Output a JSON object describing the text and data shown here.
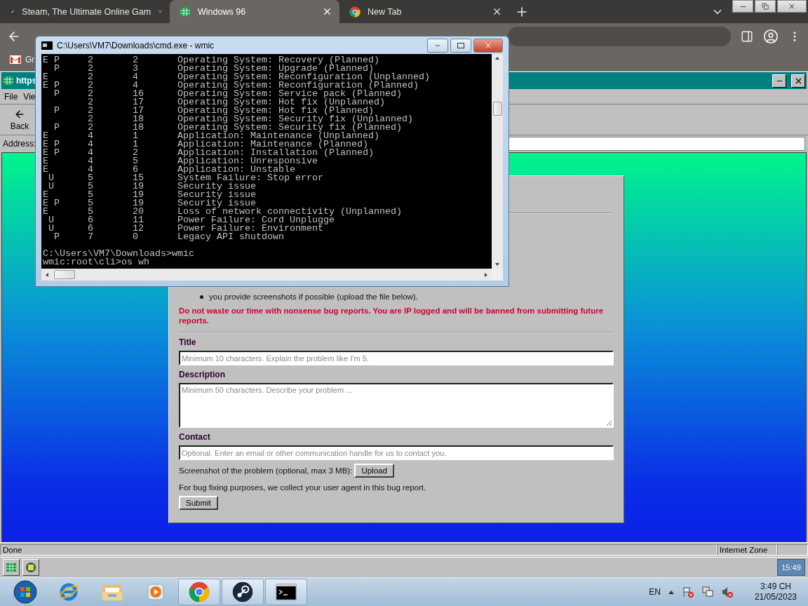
{
  "browser": {
    "tabs": [
      {
        "title": "Steam, The Ultimate Online Gam",
        "selected": false
      },
      {
        "title": "Windows 96",
        "selected": true
      },
      {
        "title": "New Tab",
        "selected": false
      }
    ],
    "bookmarks": [
      "Gr"
    ]
  },
  "ie_window": {
    "title": "https",
    "menu": [
      "File",
      "Vie"
    ],
    "back_label": "Back",
    "address_label": "Address:"
  },
  "page": {
    "bullets": [
      "you provide screenshots if possible (upload the file below)."
    ],
    "warning": "Do not waste our time with nonsense bug reports. You are IP logged and will be banned from submitting future reports.",
    "fields": [
      {
        "label": "Title",
        "placeholder": "Minimum 10 characters. Explain the problem like I'm 5.",
        "kind": "input"
      },
      {
        "label": "Description",
        "placeholder": "Minimum 50 characters. Describe your problem ...",
        "kind": "textarea"
      },
      {
        "label": "Contact",
        "placeholder": "Optional. Enter an email or other communication handle for us to contact you.",
        "kind": "input"
      }
    ],
    "upload_label": "Screenshot of the problem (optional, max 3 MB):",
    "upload_button": "Upload",
    "note": "For bug fixing purposes, we collect your user agent in this bug report.",
    "submit": "Submit"
  },
  "status_bar": {
    "text": "Done",
    "zone": "Internet Zone"
  },
  "w96_taskbar": {
    "clock": "15:49"
  },
  "cmd": {
    "title": "C:\\Users\\VM7\\Downloads\\cmd.exe - wmic",
    "output": [
      "E P     2       2       Operating System: Recovery (Planned)",
      "  P     2       3       Operating System: Upgrade (Planned)",
      "E       2       4       Operating System: Reconfiguration (Unplanned)",
      "E P     2       4       Operating System: Reconfiguration (Planned)",
      "  P     2       16      Operating System: Service pack (Planned)",
      "        2       17      Operating System: Hot fix (Unplanned)",
      "  P     2       17      Operating System: Hot fix (Planned)",
      "        2       18      Operating System: Security fix (Unplanned)",
      "  P     2       18      Operating System: Security fix (Planned)",
      "E       4       1       Application: Maintenance (Unplanned)",
      "E P     4       1       Application: Maintenance (Planned)",
      "E P     4       2       Application: Installation (Planned)",
      "E       4       5       Application: Unresponsive",
      "E       4       6       Application: Unstable",
      " U      5       15      System Failure: Stop error",
      " U      5       19      Security issue",
      "E       5       19      Security issue",
      "E P     5       19      Security issue",
      "E       5       20      Loss of network connectivity (Unplanned)",
      " U      6       11      Power Failure: Cord Unplugge",
      " U      6       12      Power Failure: Environment",
      "  P     7       0       Legacy API shutdown"
    ],
    "prompt": [
      "C:\\Users\\VM7\\Downloads>wmic",
      "wmic:root\\cli>os wh"
    ]
  },
  "taskbar": {
    "apps": [
      {
        "running": false
      },
      {
        "running": false
      },
      {
        "running": false
      },
      {
        "running": true
      },
      {
        "running": true
      },
      {
        "running": true
      }
    ],
    "language": "EN",
    "time": "3:49 CH",
    "date": "21/05/2023"
  }
}
